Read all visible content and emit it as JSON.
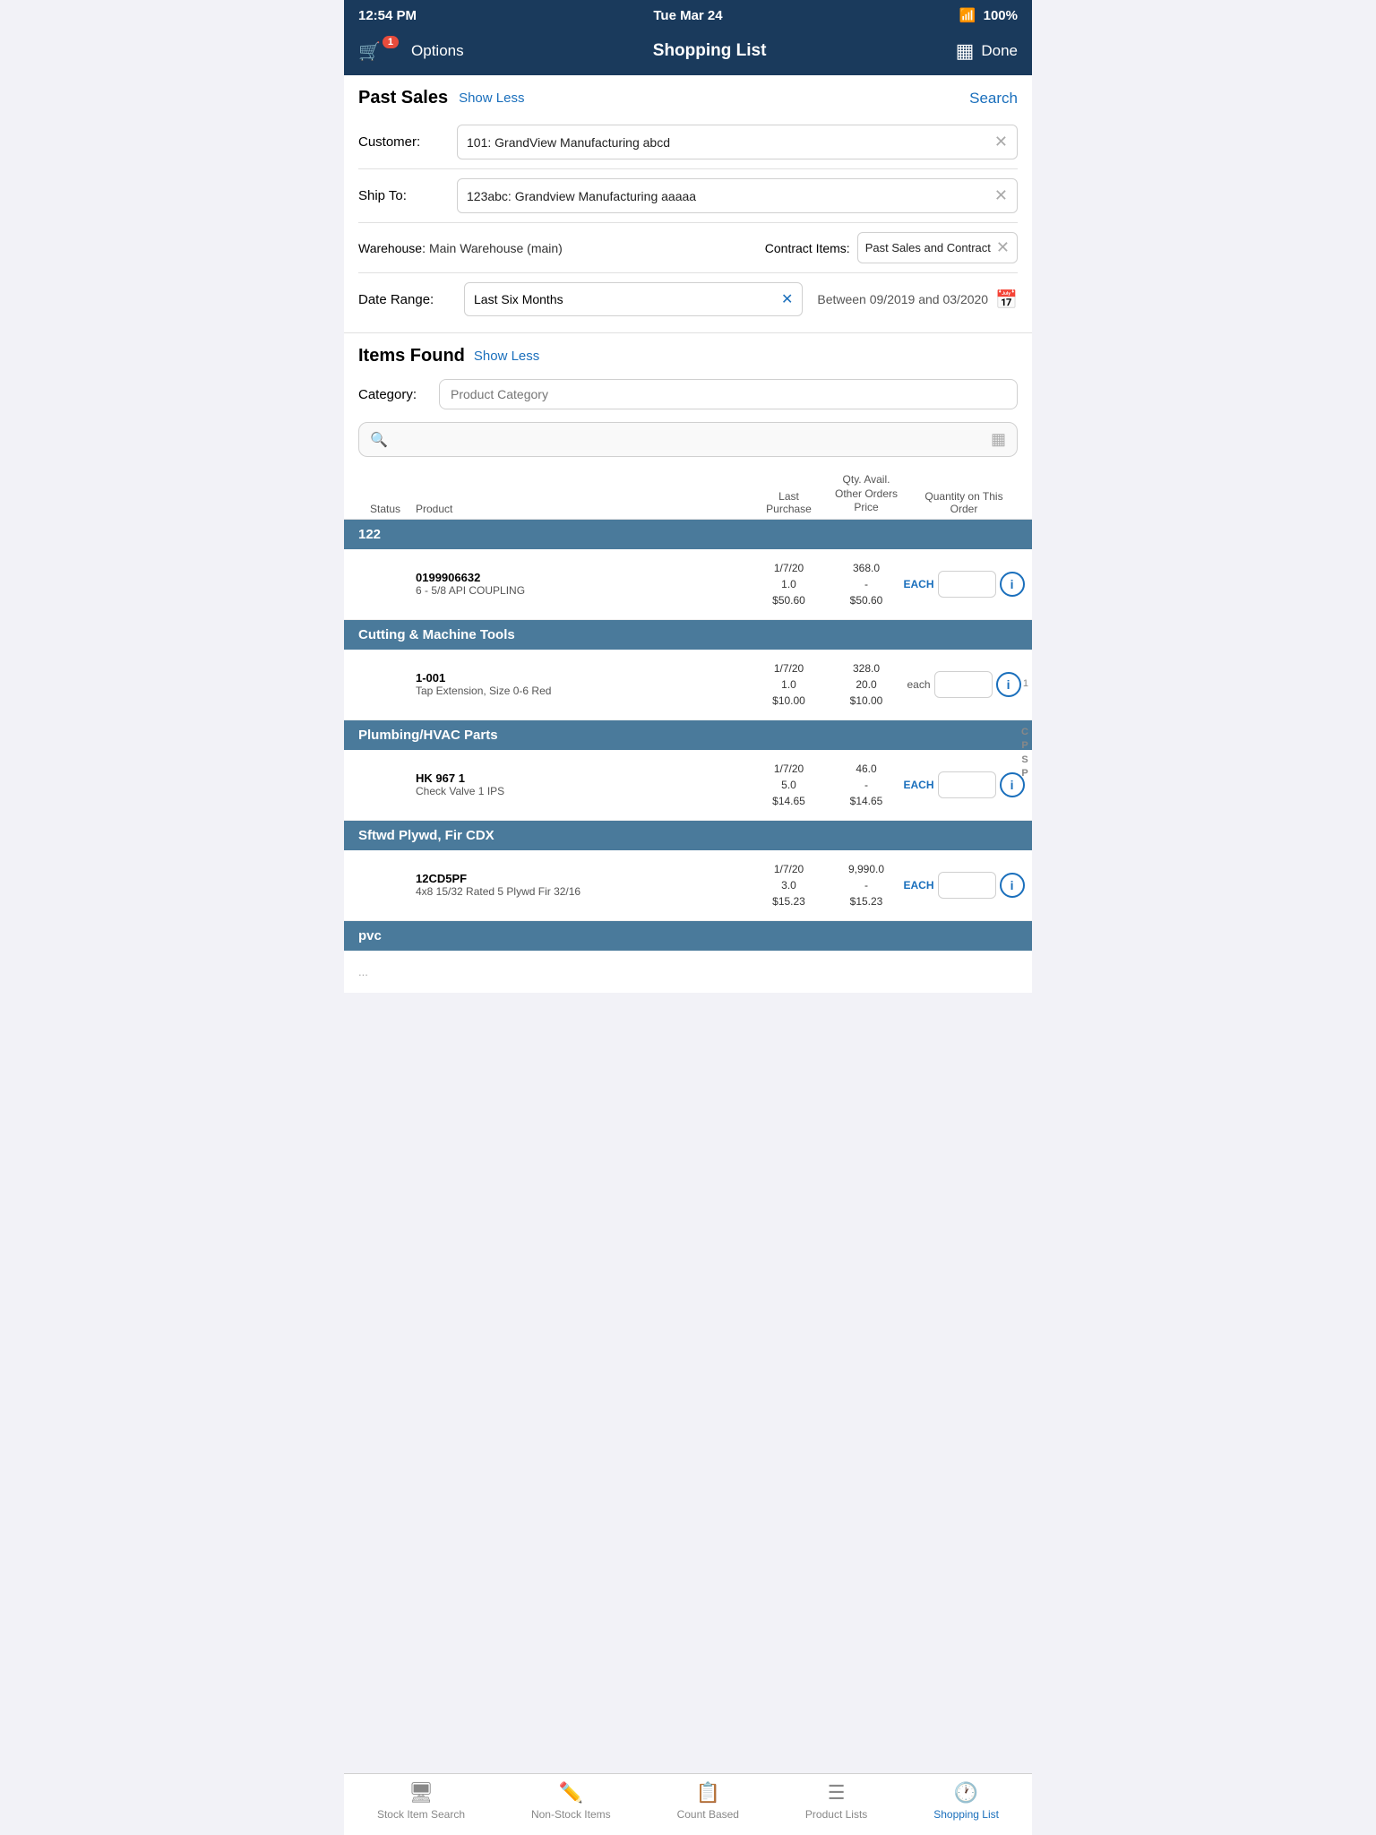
{
  "statusBar": {
    "time": "12:54 PM",
    "date": "Tue Mar 24",
    "battery": "100%",
    "wifi": true
  },
  "navbar": {
    "options_label": "Options",
    "title": "Shopping List",
    "done_label": "Done",
    "badge": "1"
  },
  "pastSales": {
    "title": "Past Sales",
    "show_less": "Show Less",
    "search": "Search",
    "customer_label": "Customer:",
    "customer_value": "101: GrandView Manufacturing abcd",
    "shipto_label": "Ship To:",
    "shipto_value": "123abc: Grandview Manufacturing aaaaa",
    "warehouse_label": "Warehouse:",
    "warehouse_value": "Main Warehouse (main)",
    "contract_label": "Contract Items:",
    "contract_value": "Past Sales and Contract",
    "daterange_label": "Date Range:",
    "daterange_value": "Last Six Months",
    "between_text": "Between  09/2019 and 03/2020"
  },
  "itemsFound": {
    "title": "Items Found",
    "show_less": "Show Less",
    "category_label": "Category:",
    "category_placeholder": "Product Category"
  },
  "tableHeader": {
    "status": "Status",
    "product": "Product",
    "last_purchase": "Last Purchase",
    "qty_avail": "Qty. Avail.",
    "other_orders": "Other Orders",
    "price": "Price",
    "quantity_order": "Quantity on This Order"
  },
  "groups": [
    {
      "name": "122",
      "products": [
        {
          "id": "0199906632",
          "name": "6 - 5/8 API COUPLING",
          "last_date": "1/7/20",
          "last_qty": "1.0",
          "last_price": "$50.60",
          "qty_avail": "368.0",
          "other": "-",
          "price": "$50.60",
          "unit": "EACH",
          "unit_style": "upper"
        }
      ]
    },
    {
      "name": "Cutting & Machine Tools",
      "products": [
        {
          "id": "1-001",
          "name": "Tap Extension, Size 0-6 Red",
          "last_date": "1/7/20",
          "last_qty": "1.0",
          "last_price": "$10.00",
          "qty_avail": "328.0",
          "other": "20.0",
          "price": "$10.00",
          "unit": "each",
          "unit_style": "lower"
        }
      ]
    },
    {
      "name": "Plumbing/HVAC Parts",
      "products": [
        {
          "id": "HK 967 1",
          "name": "Check Valve 1 IPS",
          "last_date": "1/7/20",
          "last_qty": "5.0",
          "last_price": "$14.65",
          "qty_avail": "46.0",
          "other": "-",
          "price": "$14.65",
          "unit": "EACH",
          "unit_style": "upper"
        }
      ]
    },
    {
      "name": "Sftwd Plywd, Fir CDX",
      "products": [
        {
          "id": "12CD5PF",
          "name": "4x8 15/32 Rated 5 Plywd Fir 32/16",
          "last_date": "1/7/20",
          "last_qty": "3.0",
          "last_price": "$15.23",
          "qty_avail": "9,990.0",
          "other": "-",
          "price": "$15.23",
          "unit": "EACH",
          "unit_style": "upper"
        }
      ]
    },
    {
      "name": "pvc",
      "products": []
    }
  ],
  "sideLetters": [
    "C",
    "P",
    "S",
    "P"
  ],
  "tabBar": {
    "items": [
      {
        "id": "stock-item-search",
        "label": "Stock Item Search",
        "icon": "🖥",
        "active": false
      },
      {
        "id": "non-stock-items",
        "label": "Non-Stock Items",
        "icon": "✏️",
        "active": false
      },
      {
        "id": "count-based",
        "label": "Count Based",
        "icon": "📋",
        "active": false
      },
      {
        "id": "product-lists",
        "label": "Product Lists",
        "icon": "☰",
        "active": false
      },
      {
        "id": "shopping-list",
        "label": "Shopping List",
        "icon": "🕐",
        "active": true
      }
    ]
  }
}
